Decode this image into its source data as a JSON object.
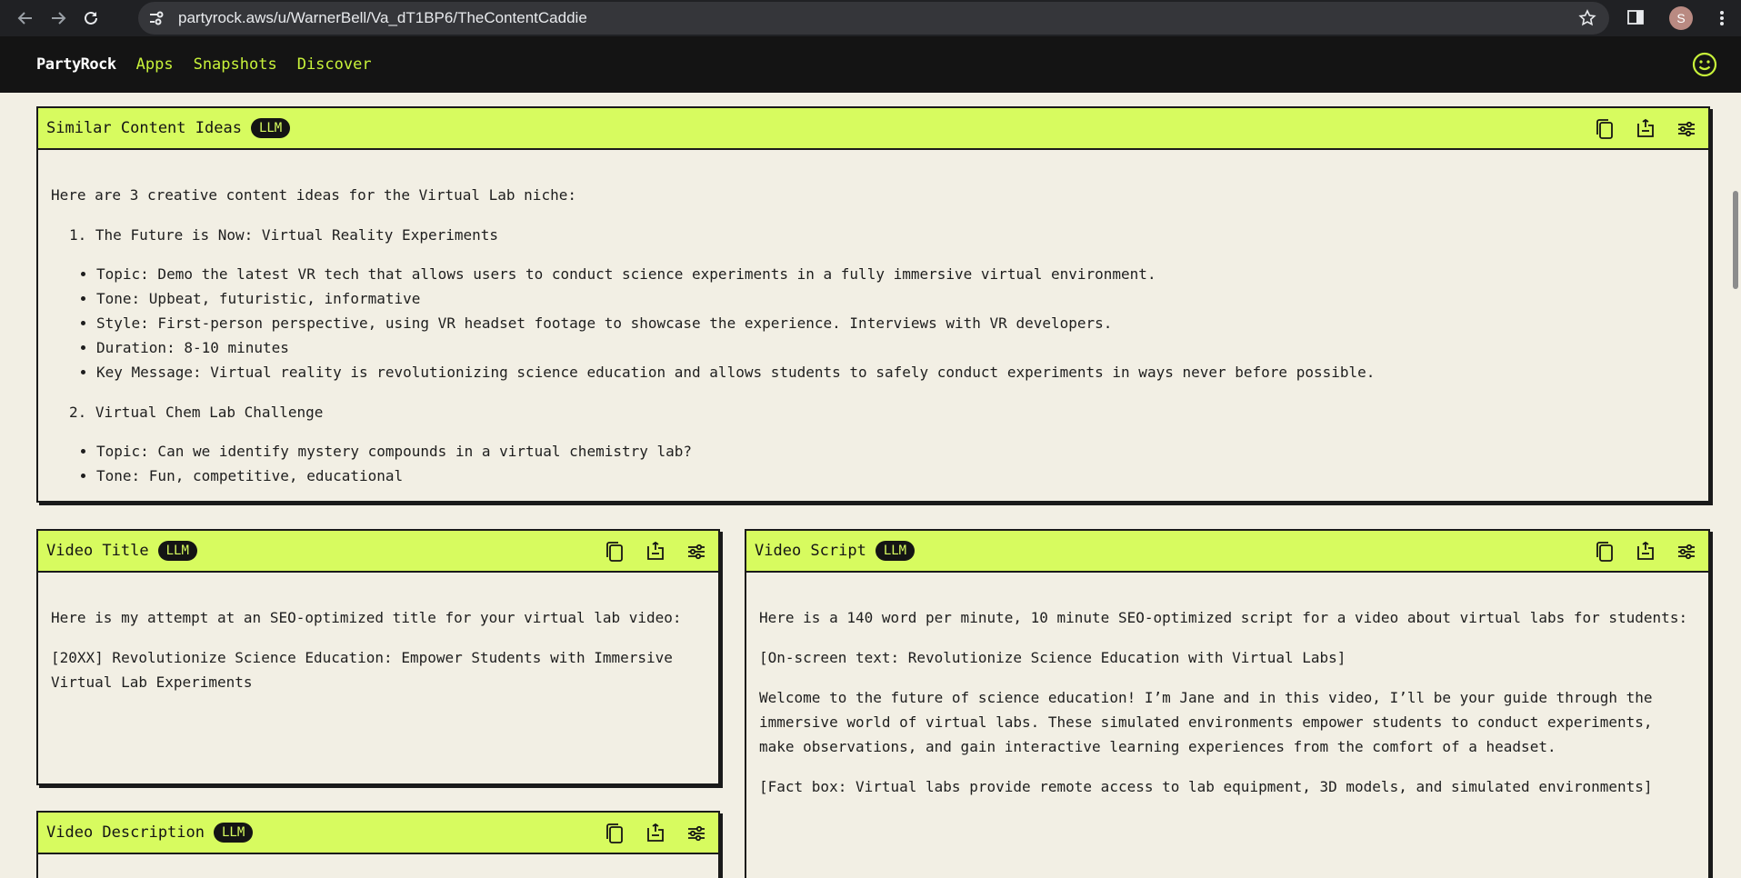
{
  "browser": {
    "url": "partyrock.aws/u/WarnerBell/Va_dT1BP6/TheContentCaddie",
    "avatar_letter": "S"
  },
  "appbar": {
    "brand": "PartyRock",
    "nav": [
      "Apps",
      "Snapshots",
      "Discover"
    ]
  },
  "cards": {
    "similar": {
      "title": "Similar Content Ideas",
      "badge": "LLM",
      "intro": "Here are 3 creative content ideas for the Virtual Lab niche:",
      "item1_title": "The Future is Now: Virtual Reality Experiments",
      "item1_bullets": [
        "Topic: Demo the latest VR tech that allows users to conduct science experiments in a fully immersive virtual environment.",
        "Tone: Upbeat, futuristic, informative",
        "Style: First-person perspective, using VR headset footage to showcase the experience. Interviews with VR developers.",
        "Duration: 8-10 minutes",
        "Key Message: Virtual reality is revolutionizing science education and allows students to safely conduct experiments in ways never before possible."
      ],
      "item2_title": "Virtual Chem Lab Challenge",
      "item2_bullets": [
        "Topic: Can we identify mystery compounds in a virtual chemistry lab?",
        "Tone: Fun, competitive, educational"
      ]
    },
    "video_title": {
      "title": "Video Title",
      "badge": "LLM",
      "para1": "Here is my attempt at an SEO-optimized title for your virtual lab video:",
      "para2": "[20XX] Revolutionize Science Education: Empower Students with Immersive Virtual Lab Experiments"
    },
    "video_description": {
      "title": "Video Description",
      "badge": "LLM"
    },
    "video_script": {
      "title": "Video Script",
      "badge": "LLM",
      "para1": "Here is a 140 word per minute, 10 minute SEO-optimized script for a video about virtual labs for students:",
      "para2": "[On-screen text: Revolutionize Science Education with Virtual Labs]",
      "para3": "Welcome to the future of science education! I’m Jane and in this video, I’ll be your guide through the immersive world of virtual labs. These simulated environments empower students to conduct experiments, make observations, and gain interactive learning experiences from the comfort of a headset.",
      "para4": "[Fact box: Virtual labs provide remote access to lab equipment, 3D models, and simulated environments]"
    }
  },
  "icons": {
    "copy": "copy-icon",
    "export": "export-icon",
    "settings": "settings-sliders-icon"
  },
  "colors": {
    "accent": "#d7fb5f",
    "nav_link": "#c8f23a",
    "header_bg": "#141414",
    "page_bg": "#f2efe4"
  }
}
